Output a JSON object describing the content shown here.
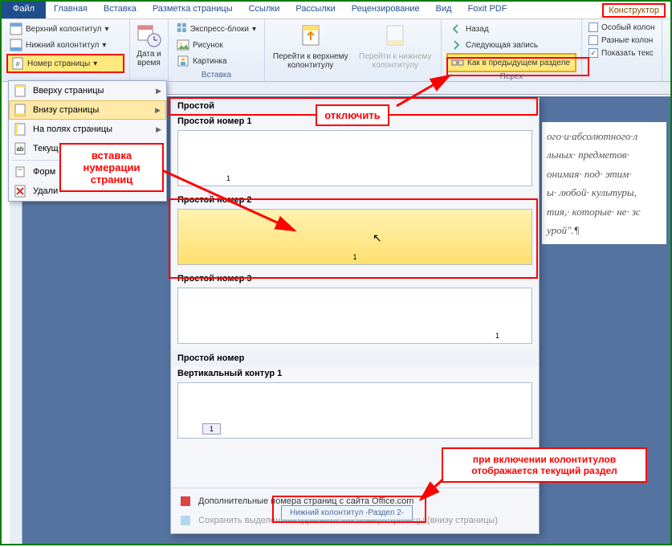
{
  "tabs": {
    "file": "Файл",
    "home": "Главная",
    "insert": "Вставка",
    "layout": "Разметка страницы",
    "refs": "Ссылки",
    "mail": "Рассылки",
    "review": "Рецензирование",
    "view": "Вид",
    "foxit": "Foxit PDF",
    "designer": "Конструктор"
  },
  "ribbon": {
    "topHeader": "Верхний колонтитул",
    "bottomHeader": "Нижний колонтитул",
    "pageNumber": "Номер страницы",
    "dateTime": "Дата и время",
    "express": "Экспресс-блоки",
    "picture": "Рисунок",
    "clipart": "Картинка",
    "gotoTop": "Перейти к верхнему колонтитулу",
    "gotoBottom": "Перейти к нижнему колонтитулу",
    "back": "Назад",
    "nextRec": "Следующая запись",
    "linkPrev": "Как в предыдущем разделе",
    "insertGroup": "Вставка",
    "navGroup": "Перех",
    "specialHeader": "Особый колон",
    "diffHeaders": "Разные колон",
    "showText": "Показать текс"
  },
  "menu": {
    "top": "Вверху страницы",
    "bottom": "Внизу страницы",
    "margins": "На полях страницы",
    "current": "Текущ",
    "format": "Форм",
    "remove": "Удали"
  },
  "gallery": {
    "simple": "Простой",
    "num1": "Простой номер 1",
    "num2": "Простой номер 2",
    "num3": "Простой номер 3",
    "simpleNum": "Простой номер",
    "vert1": "Вертикальный контур 1",
    "office": "Дополнительные номера страниц с сайта Office.com",
    "save": "Сохранить выделенный фрагмент как номер страницы (внизу страницы)"
  },
  "callouts": {
    "insertNum": "вставка нумерации страниц",
    "disable": "отключить",
    "footerInfo": "при включении колонтитулов отображается текущий раздел"
  },
  "footerTag": "Нижний колонтитул -Раздел 2-",
  "docText": {
    "l1": "ого·и·абсолютного·л",
    "l2": "льных· предметов·",
    "l3": "онимая· под· этим·",
    "l4": "ы· любой· культуры,",
    "l5": "тия,· которые· не· зс",
    "l6": "урой\".¶"
  }
}
